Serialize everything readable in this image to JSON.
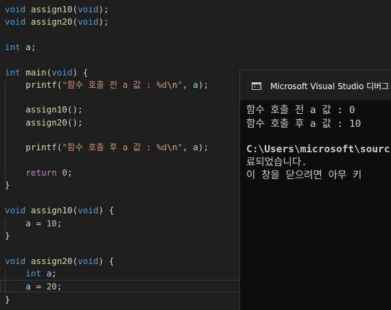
{
  "editor": {
    "lines": {
      "l1": {
        "kw": "void",
        "fn": "assign10",
        "p1": "(",
        "kw2": "void",
        "p2": ");"
      },
      "l2": {
        "kw": "void",
        "fn": "assign20",
        "p1": "(",
        "kw2": "void",
        "p2": ");"
      },
      "l4": {
        "kw": "int",
        "var": "a",
        "p": ";"
      },
      "l6": {
        "kw": "int",
        "fn": "main",
        "p1": "(",
        "kw2": "void",
        "p2": ") {"
      },
      "l7": {
        "fn": "printf",
        "p1": "(",
        "str": "\"함수 호출 전 a 값 : %d",
        "esc": "\\n",
        "str2": "\"",
        "p2": ", ",
        "var": "a",
        "p3": ");"
      },
      "l9": {
        "fn": "assign10",
        "p": "();"
      },
      "l10": {
        "fn": "assign20",
        "p": "();"
      },
      "l12": {
        "fn": "printf",
        "p1": "(",
        "str": "\"함수 호출 후 a 값 : %d",
        "esc": "\\n",
        "str2": "\"",
        "p2": ", ",
        "var": "a",
        "p3": ");"
      },
      "l14": {
        "ctl": "return",
        "num": "0",
        "p": ";"
      },
      "l15": {
        "p": "}"
      },
      "l17": {
        "kw": "void",
        "fn": "assign10",
        "p1": "(",
        "kw2": "void",
        "p2": ") {"
      },
      "l18": {
        "var": "a",
        "p1": " = ",
        "num": "10",
        "p2": ";"
      },
      "l19": {
        "p": "}"
      },
      "l21": {
        "kw": "void",
        "fn": "assign20",
        "p1": "(",
        "kw2": "void",
        "p2": ") {"
      },
      "l22": {
        "kw": "int",
        "var": "a",
        "p": ";"
      },
      "l23": {
        "var": "a",
        "p1": " = ",
        "num": "20",
        "p2": ";"
      },
      "l24": {
        "p": "}"
      }
    }
  },
  "console": {
    "title": "Microsoft Visual Studio 디버그",
    "icon": "console-app-icon",
    "icon_glyph": "C:\\",
    "output": [
      "함수 호출 전 a 값 : 0",
      "함수 호출 후 a 값 : 10",
      "",
      "C:\\Users\\microsoft\\sourc",
      "료되었습니다.",
      "이 창을 닫으려면 아무 키"
    ]
  },
  "colors": {
    "editor_bg": "#1e1e1e",
    "keyword": "#569cd6",
    "control": "#c586c0",
    "function": "#dcdcaa",
    "variable": "#9cdcfe",
    "string": "#ce9178",
    "number": "#b5cea8",
    "console_bg": "#0c0c0c"
  }
}
